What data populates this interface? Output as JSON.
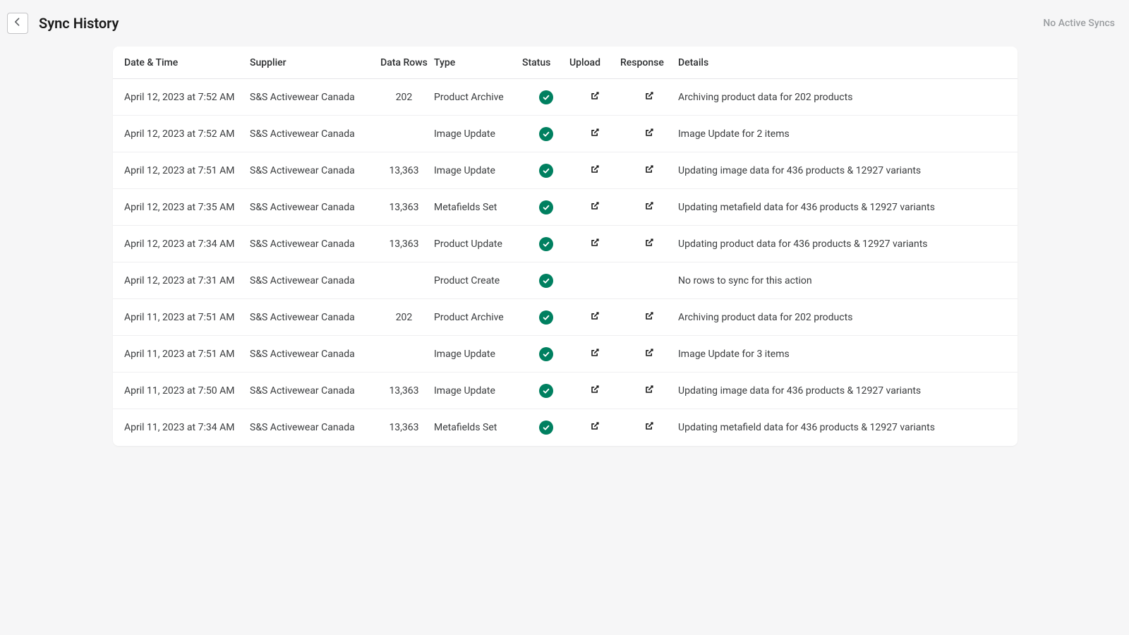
{
  "header": {
    "title": "Sync History",
    "status_text": "No Active Syncs"
  },
  "table": {
    "columns": {
      "date": "Date & Time",
      "supplier": "Supplier",
      "rows": "Data Rows",
      "type": "Type",
      "status": "Status",
      "upload": "Upload",
      "response": "Response",
      "details": "Details"
    },
    "rows": [
      {
        "date": "April 12, 2023 at 7:52 AM",
        "supplier": "S&S Activewear Canada",
        "rows": "202",
        "type": "Product Archive",
        "status": "success",
        "upload": true,
        "response": true,
        "details": "Archiving product data for 202 products"
      },
      {
        "date": "April 12, 2023 at 7:52 AM",
        "supplier": "S&S Activewear Canada",
        "rows": "",
        "type": "Image Update",
        "status": "success",
        "upload": true,
        "response": true,
        "details": "Image Update for 2 items"
      },
      {
        "date": "April 12, 2023 at 7:51 AM",
        "supplier": "S&S Activewear Canada",
        "rows": "13,363",
        "type": "Image Update",
        "status": "success",
        "upload": true,
        "response": true,
        "details": "Updating image data for 436 products & 12927 variants"
      },
      {
        "date": "April 12, 2023 at 7:35 AM",
        "supplier": "S&S Activewear Canada",
        "rows": "13,363",
        "type": "Metafields Set",
        "status": "success",
        "upload": true,
        "response": true,
        "details": "Updating metafield data for 436 products & 12927 variants"
      },
      {
        "date": "April 12, 2023 at 7:34 AM",
        "supplier": "S&S Activewear Canada",
        "rows": "13,363",
        "type": "Product Update",
        "status": "success",
        "upload": true,
        "response": true,
        "details": "Updating product data for 436 products & 12927 variants"
      },
      {
        "date": "April 12, 2023 at 7:31 AM",
        "supplier": "S&S Activewear Canada",
        "rows": "",
        "type": "Product Create",
        "status": "success",
        "upload": false,
        "response": false,
        "details": "No rows to sync for this action"
      },
      {
        "date": "April 11, 2023 at 7:51 AM",
        "supplier": "S&S Activewear Canada",
        "rows": "202",
        "type": "Product Archive",
        "status": "success",
        "upload": true,
        "response": true,
        "details": "Archiving product data for 202 products"
      },
      {
        "date": "April 11, 2023 at 7:51 AM",
        "supplier": "S&S Activewear Canada",
        "rows": "",
        "type": "Image Update",
        "status": "success",
        "upload": true,
        "response": true,
        "details": "Image Update for 3 items"
      },
      {
        "date": "April 11, 2023 at 7:50 AM",
        "supplier": "S&S Activewear Canada",
        "rows": "13,363",
        "type": "Image Update",
        "status": "success",
        "upload": true,
        "response": true,
        "details": "Updating image data for 436 products & 12927 variants"
      },
      {
        "date": "April 11, 2023 at 7:34 AM",
        "supplier": "S&S Activewear Canada",
        "rows": "13,363",
        "type": "Metafields Set",
        "status": "success",
        "upload": true,
        "response": true,
        "details": "Updating metafield data for 436 products & 12927 variants"
      }
    ]
  },
  "icons": {
    "status_success": "success-check-icon",
    "external_link": "external-link-icon",
    "back_arrow": "arrow-left-icon"
  },
  "colors": {
    "success_badge": "#008060",
    "page_bg": "#f6f6f7",
    "text_muted": "#9a9da0"
  }
}
